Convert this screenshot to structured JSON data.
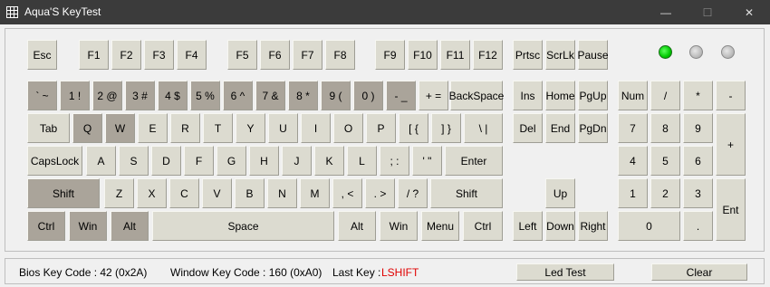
{
  "window": {
    "title": "Aqua'S KeyTest",
    "min_glyph": "—",
    "max_glyph": "☐",
    "close_glyph": "✕"
  },
  "keys": {
    "esc": "Esc",
    "f1": "F1",
    "f2": "F2",
    "f3": "F3",
    "f4": "F4",
    "f5": "F5",
    "f6": "F6",
    "f7": "F7",
    "f8": "F8",
    "f9": "F9",
    "f10": "F10",
    "f11": "F11",
    "f12": "F12",
    "prtsc": "Prtsc",
    "scrlk": "ScrLk",
    "pause": "Pause",
    "backtick": "` ~",
    "1": "1 !",
    "2": "2 @",
    "3": "3 #",
    "4": "4 $",
    "5": "5 %",
    "6": "6 ^",
    "7": "7 &",
    "8": "8 *",
    "9": "9 (",
    "0": "0 )",
    "minus": "- _",
    "equal": "+ =",
    "backspace": "BackSpace",
    "tab": "Tab",
    "q": "Q",
    "w": "W",
    "e": "E",
    "r": "R",
    "t": "T",
    "y": "Y",
    "u": "U",
    "i": "I",
    "o": "O",
    "p": "P",
    "lbracket": "[ {",
    "rbracket": "] }",
    "backslash": "\\ |",
    "capslock": "CapsLock",
    "a": "A",
    "s": "S",
    "d": "D",
    "f": "F",
    "g": "G",
    "h": "H",
    "j": "J",
    "k": "K",
    "l": "L",
    "semicolon": "; :",
    "quote": "' \"",
    "enter": "Enter",
    "lshift": "Shift",
    "z": "Z",
    "x": "X",
    "c": "C",
    "v": "V",
    "b": "B",
    "n": "N",
    "m": "M",
    "comma": ", <",
    "period": ". >",
    "slash": "/ ?",
    "rshift": "Shift",
    "lctrl": "Ctrl",
    "lwin": "Win",
    "lalt": "Alt",
    "space": "Space",
    "ralt": "Alt",
    "rwin": "Win",
    "menu": "Menu",
    "rctrl": "Ctrl",
    "ins": "Ins",
    "home": "Home",
    "pgup": "PgUp",
    "del": "Del",
    "end": "End",
    "pgdn": "PgDn",
    "up": "Up",
    "left": "Left",
    "down": "Down",
    "right": "Right",
    "numlock": "Num",
    "np_div": "/",
    "np_mul": "*",
    "np_minus": "-",
    "np7": "7",
    "np8": "8",
    "np9": "9",
    "np_plus": "+",
    "np4": "4",
    "np5": "5",
    "np6": "6",
    "np1": "1",
    "np2": "2",
    "np3": "3",
    "np_enter": "Ent",
    "np0": "0",
    "np_dot": "."
  },
  "pressed_keys": [
    "backtick",
    "1",
    "2",
    "3",
    "4",
    "5",
    "6",
    "7",
    "8",
    "9",
    "0",
    "minus",
    "q",
    "w",
    "lshift",
    "lctrl",
    "lwin",
    "lalt"
  ],
  "leds": {
    "num_lock": true,
    "caps_lock": false,
    "scroll_lock": false
  },
  "status": {
    "bios_label": "Bios Key Code : 42 (0x2A)",
    "window_label": "Window Key Code : 160 (0xA0)",
    "lastkey_label": "Last Key :",
    "lastkey_value": "LSHIFT",
    "led_test": "Led Test",
    "clear": "Clear"
  },
  "colors": {
    "key": "#dcdbd0",
    "pressed": "#aaa49a",
    "led_on": "#00c800",
    "last_key": "#e00000",
    "titlebar": "#3b3b3b"
  }
}
